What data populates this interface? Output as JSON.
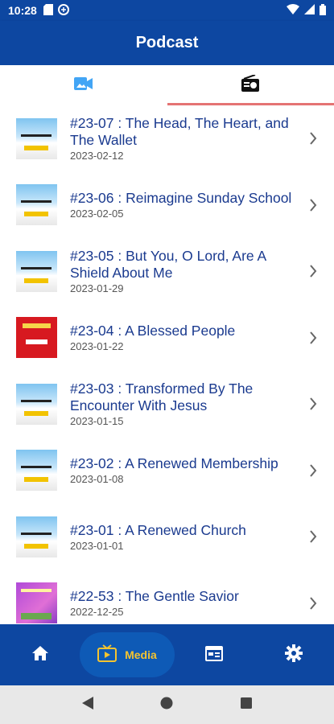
{
  "status_bar": {
    "time": "10:28"
  },
  "app_bar": {
    "title": "Podcast"
  },
  "tabs": [
    {
      "icon": "video-icon",
      "active": false
    },
    {
      "icon": "radio-icon",
      "active": true
    }
  ],
  "episodes": [
    {
      "title": "#23-07 : The Head, The Heart, and The Wallet",
      "date": "2023-02-12",
      "thumb": "sky"
    },
    {
      "title": "#23-06 : Reimagine Sunday School",
      "date": "2023-02-05",
      "thumb": "sky"
    },
    {
      "title": "#23-05 : But You, O Lord, Are A Shield About Me",
      "date": "2023-01-29",
      "thumb": "sky"
    },
    {
      "title": "#23-04 : A Blessed People",
      "date": "2023-01-22",
      "thumb": "red"
    },
    {
      "title": "#23-03 : Transformed By The Encounter With Jesus",
      "date": "2023-01-15",
      "thumb": "sky"
    },
    {
      "title": "#23-02 : A Renewed Membership",
      "date": "2023-01-08",
      "thumb": "sky"
    },
    {
      "title": "#23-01 : A Renewed Church",
      "date": "2023-01-01",
      "thumb": "sky"
    },
    {
      "title": "#22-53 : The Gentle Savior",
      "date": "2022-12-25",
      "thumb": "purple"
    }
  ],
  "bottom_nav": {
    "items": [
      {
        "icon": "home-icon"
      },
      {
        "icon": "media-icon",
        "label": "Media",
        "active": true
      },
      {
        "icon": "calendar-icon"
      },
      {
        "icon": "settings-icon"
      }
    ]
  },
  "colors": {
    "primary": "#0d47a1",
    "accent": "#f4c430",
    "title_text": "#1a3a8f",
    "tab_indicator": "#e57373"
  }
}
